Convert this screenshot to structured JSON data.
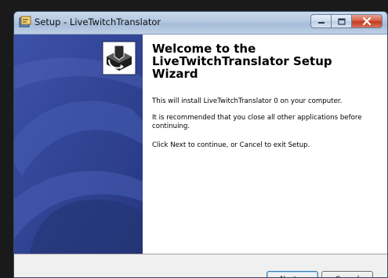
{
  "window": {
    "title": "Setup - LiveTwitchTranslator"
  },
  "caption_buttons": {
    "minimize_icon": "minimize-icon",
    "maximize_icon": "maximize-icon",
    "close_icon": "close-icon"
  },
  "wizard": {
    "heading": "Welcome to the LiveTwitchTranslator Setup Wizard",
    "paragraphs": [
      "This will install LiveTwitchTranslator 0 on your computer.",
      "It is recommended that you close all other applications before continuing.",
      "Click Next to continue, or Cancel to exit Setup."
    ]
  },
  "buttons": {
    "next": "Next >",
    "cancel": "Cancel"
  },
  "colors": {
    "sidebar": "#2c3e8a",
    "close_button": "#c13a22"
  }
}
